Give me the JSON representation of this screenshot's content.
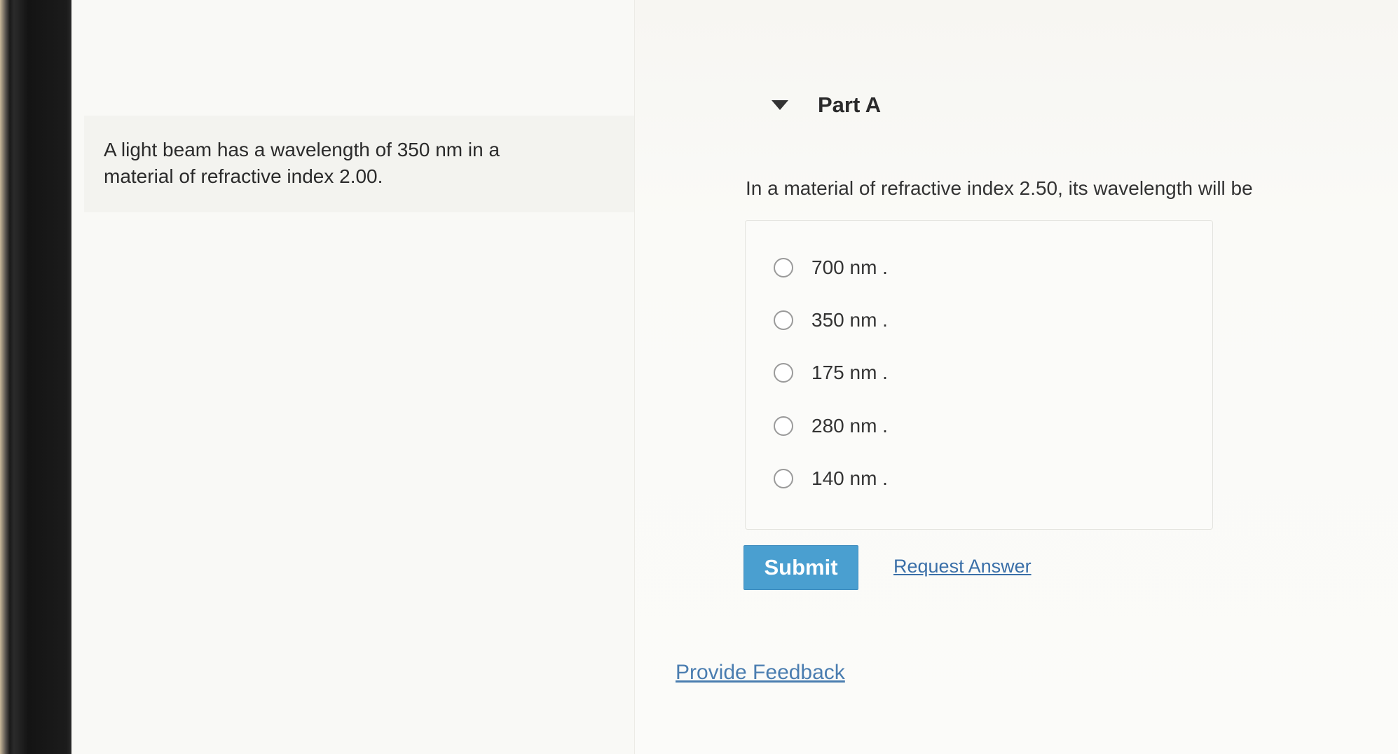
{
  "context": {
    "text": "A light beam has a wavelength of 350 nm in a material of refractive index 2.00."
  },
  "part": {
    "title": "Part A",
    "question": "In a material of refractive index 2.50, its wavelength will be",
    "options": [
      {
        "label": "700 nm ."
      },
      {
        "label": "350 nm ."
      },
      {
        "label": "175 nm ."
      },
      {
        "label": "280 nm ."
      },
      {
        "label": "140 nm ."
      }
    ]
  },
  "actions": {
    "submit_label": "Submit",
    "request_answer_label": "Request Answer"
  },
  "footer": {
    "feedback_label": "Provide Feedback"
  },
  "colors": {
    "submit_button": "#4a9fd0",
    "link": "#3a6fa8"
  },
  "icons": {
    "collapse": "caret-down-icon",
    "option": "radio-circle"
  }
}
